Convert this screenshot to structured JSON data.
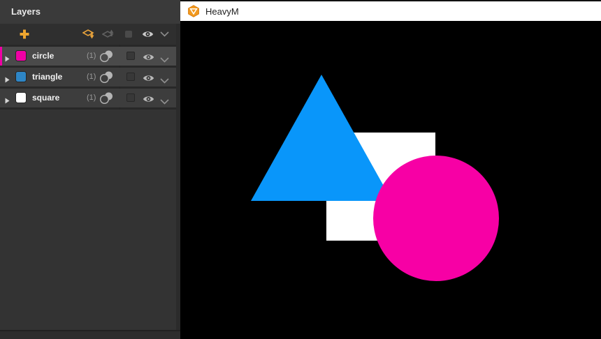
{
  "tab_bar": {
    "app_name": "HeavyM",
    "background": "#FFFFFF",
    "logo_color": "#F2991E"
  },
  "layers_panel": {
    "title": "Layers",
    "accent_color": "#EFA62F",
    "selection_color": "#F000A5",
    "selected_layer": "circle",
    "items": [
      {
        "name": "circle",
        "count_label": "(1)",
        "color": "#F000A5",
        "selected": true
      },
      {
        "name": "triangle",
        "count_label": "(1)",
        "color": "#2E86C6",
        "selected": false
      },
      {
        "name": "square",
        "count_label": "(1)",
        "color": "#FFFFFF",
        "selected": false
      }
    ]
  },
  "canvas": {
    "background": "#000000",
    "shapes": [
      {
        "type": "square",
        "color": "#FFFFFF"
      },
      {
        "type": "triangle",
        "color": "#0996FA"
      },
      {
        "type": "circle",
        "color": "#F700A5"
      }
    ]
  }
}
